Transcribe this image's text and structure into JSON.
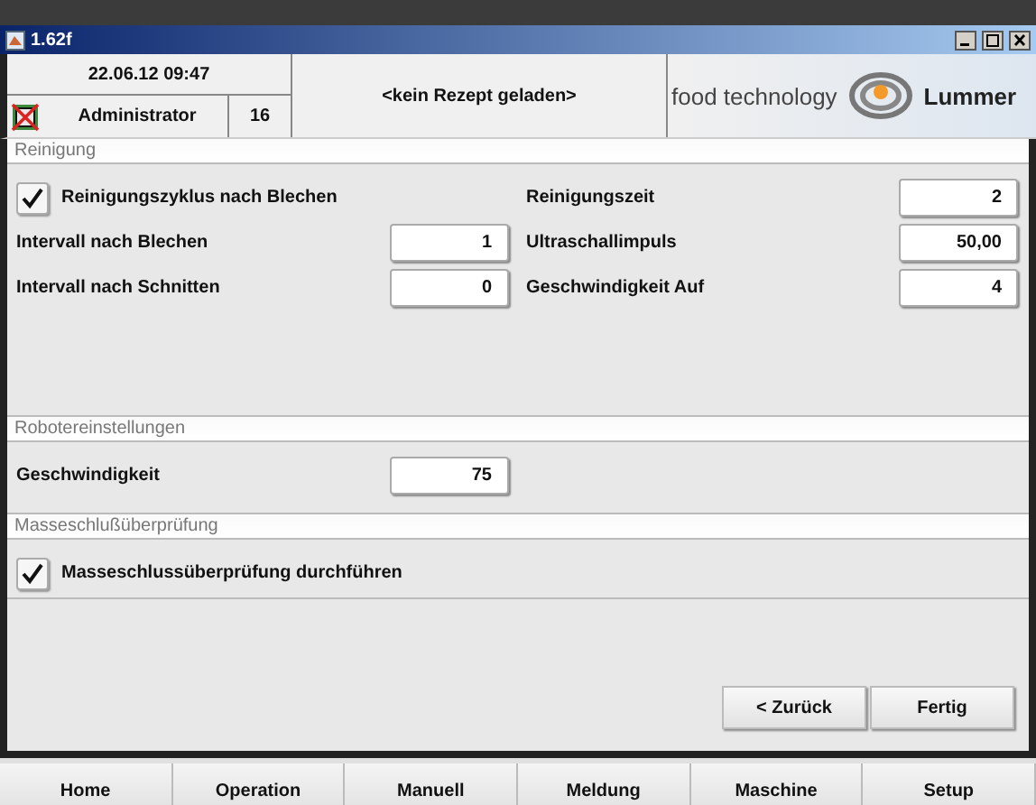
{
  "window": {
    "title": "1.62f"
  },
  "header": {
    "datetime": "22.06.12 09:47",
    "user": "Administrator",
    "number": "16",
    "recipe": "<kein Rezept geladen>",
    "brand": "food technology",
    "brand_name": "Lummer"
  },
  "sections": [
    {
      "title": "Reinigung",
      "columns": [
        [
          {
            "kind": "checkbox",
            "label": "Reinigungszyklus nach Blechen",
            "checked": true
          },
          {
            "kind": "field",
            "label": "Intervall nach Blechen",
            "value": "1"
          },
          {
            "kind": "field",
            "label": "Intervall nach Schnitten",
            "value": "0"
          }
        ],
        [
          {
            "kind": "field",
            "label": "Reinigungszeit",
            "value": "2"
          },
          {
            "kind": "field",
            "label": "Ultraschallimpuls",
            "value": "50,00"
          },
          {
            "kind": "field",
            "label": "Geschwindigkeit Auf",
            "value": "4"
          }
        ]
      ]
    },
    {
      "title": "Robotereinstellungen",
      "columns": [
        [
          {
            "kind": "field",
            "label": "Geschwindigkeit",
            "value": "75"
          }
        ]
      ]
    },
    {
      "title": "Masseschlußüberprüfung",
      "columns": [
        [
          {
            "kind": "checkbox",
            "label": "Masseschlussüberprüfung durchführen",
            "checked": true
          }
        ]
      ]
    }
  ],
  "buttons": [
    "< Zurück",
    "Fertig"
  ],
  "nav": [
    "Home",
    "Operation",
    "Manuell",
    "Meldung",
    "Maschine",
    "Setup"
  ]
}
